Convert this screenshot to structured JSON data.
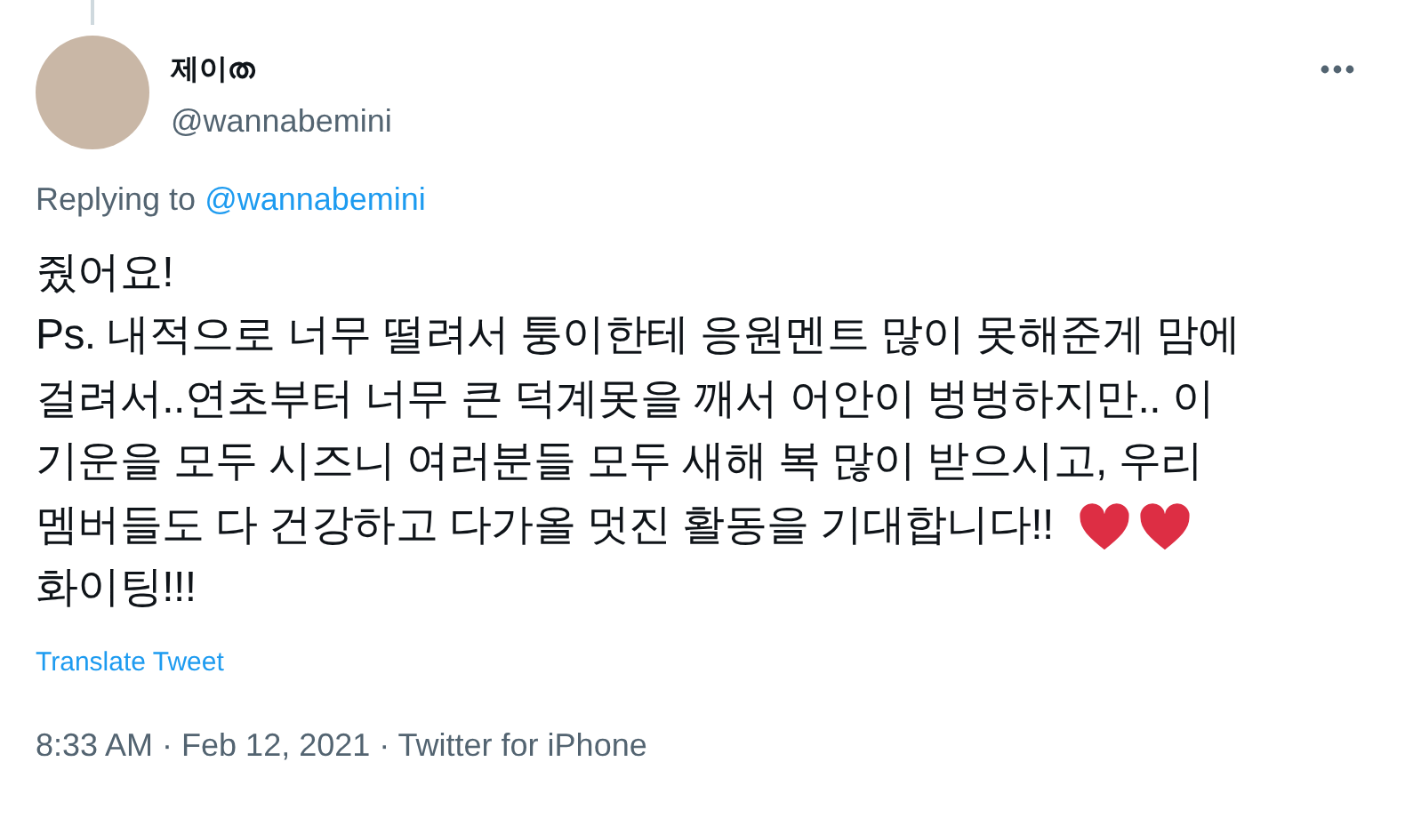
{
  "tweet": {
    "display_name": "제이ത",
    "handle": "@wannabemini",
    "replying_label": "Replying to",
    "replying_to": "@wannabemini",
    "body_lines": [
      {
        "text": "줬어요!"
      },
      {
        "text": "Ps. 내적으로 너무 떨려서 퉁이한테 응원멘트 많이 못해준게 맘에"
      },
      {
        "text": "걸려서..연초부터 너무 큰 덕계못을 깨서 어안이 벙벙하지만.. 이"
      },
      {
        "text": "기운을 모두 시즈니 여러분들 모두 새해 복 많이 받으시고, 우리"
      },
      {
        "text": "멤버들도 다 건강하고 다가올 멋진 활동을 기대합니다!!",
        "emoji": [
          {
            "kind": "heart"
          },
          {
            "kind": "heart"
          }
        ]
      },
      {
        "text": "화이팅!!!"
      }
    ],
    "translate": "Translate Tweet",
    "timestamp": "8:33 AM · Feb 12, 2021 · Twitter for iPhone"
  }
}
